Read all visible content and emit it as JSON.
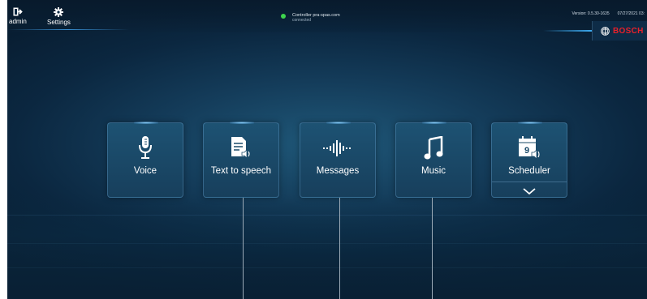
{
  "topbar": {
    "admin_label": "admin",
    "settings_label": "Settings",
    "controller_name": "Controller pra-spas.com",
    "controller_status": "connected",
    "status_color": "#3dd34d",
    "version": "Version: 0.5.30-1635",
    "datetime": "07/27/2021 03:"
  },
  "brand": {
    "name": "BOSCH",
    "color": "#e8202a"
  },
  "tiles": [
    {
      "label": "Voice",
      "icon": "microphone-icon"
    },
    {
      "label": "Text to speech",
      "icon": "document-speaker-icon"
    },
    {
      "label": "Messages",
      "icon": "waveform-icon"
    },
    {
      "label": "Music",
      "icon": "music-note-icon"
    },
    {
      "label": "Scheduler",
      "icon": "calendar-speaker-icon",
      "calendar_day": "9",
      "expand_icon": "chevron-down-icon"
    }
  ]
}
